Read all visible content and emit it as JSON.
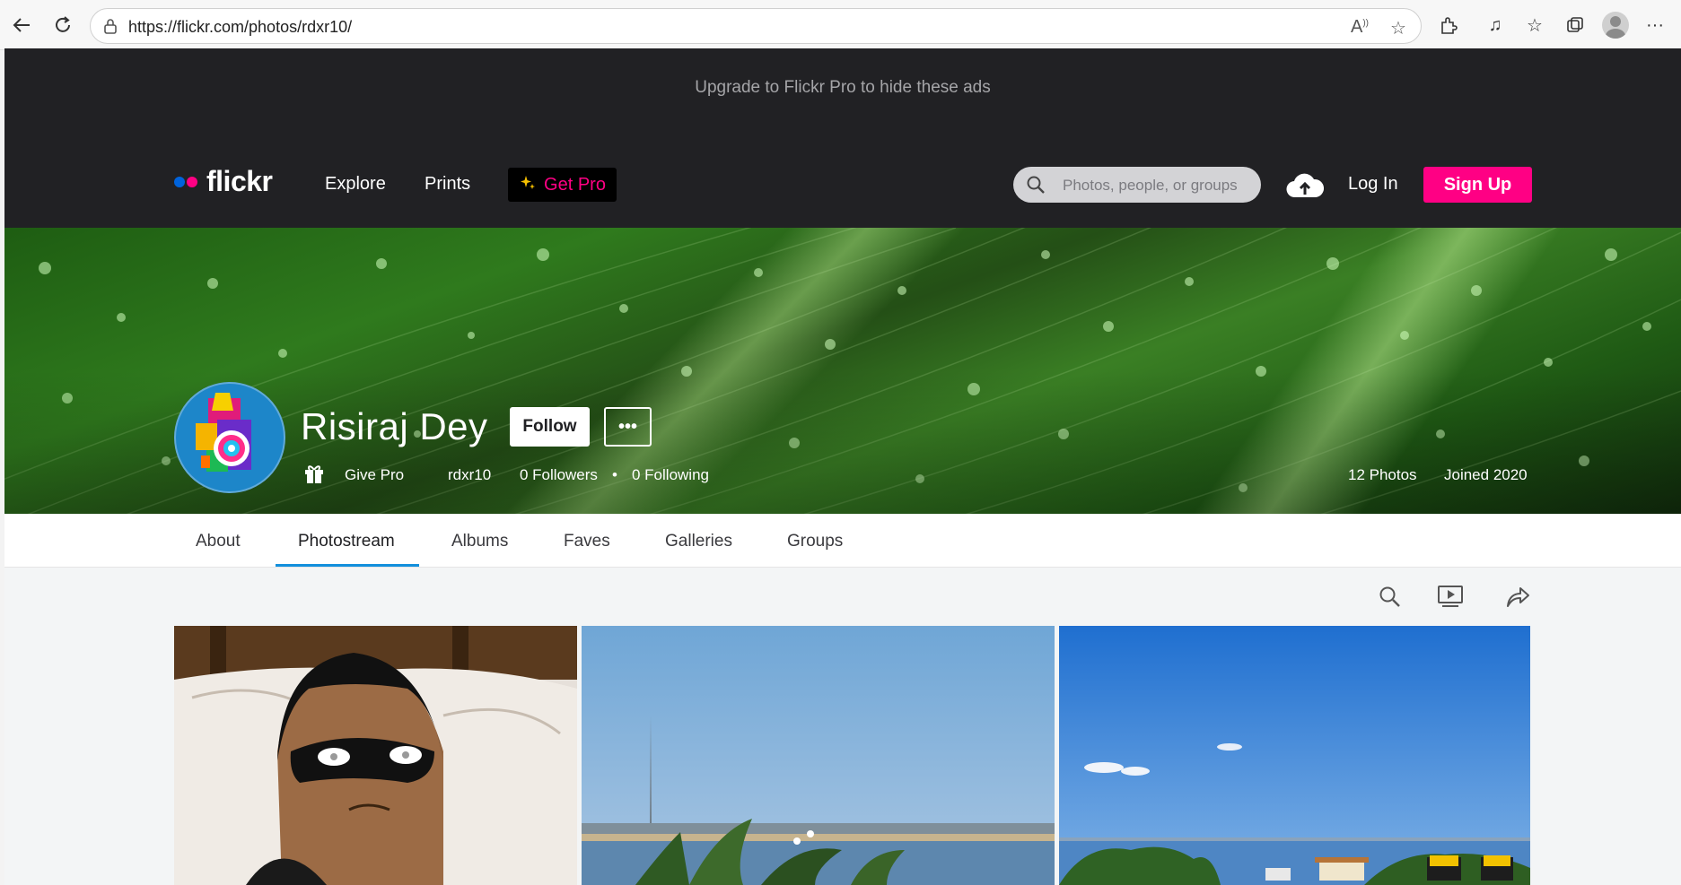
{
  "browser": {
    "url": "https://flickr.com/photos/rdxr10/",
    "icons": [
      "back-icon",
      "refresh-icon",
      "lock-icon",
      "read-aloud-icon",
      "favorite-star-icon",
      "extensions-icon",
      "media-icon",
      "favorites-icon",
      "collections-icon",
      "profile-icon",
      "more-icon"
    ]
  },
  "ad": {
    "text": "Upgrade to Flickr Pro to hide these ads"
  },
  "header": {
    "logo": "flickr",
    "nav": {
      "explore": "Explore",
      "prints": "Prints",
      "get_pro": "Get Pro"
    },
    "search_placeholder": "Photos, people, or groups",
    "login": "Log In",
    "signup": "Sign Up",
    "colors": {
      "brand_pink": "#ff0084",
      "brand_blue": "#0063dc",
      "bar": "#212124"
    }
  },
  "profile": {
    "name": "Risiraj Dey",
    "follow_label": "Follow",
    "more_label": "•••",
    "give_pro": "Give Pro",
    "username": "rdxr10",
    "followers": "0 Followers",
    "separator": "•",
    "following": "0 Following",
    "photos": "12 Photos",
    "joined": "Joined 2020"
  },
  "tabs": [
    "About",
    "Photostream",
    "Albums",
    "Faves",
    "Galleries",
    "Groups"
  ],
  "active_tab": "Photostream",
  "tools": [
    "search-icon",
    "slideshow-icon",
    "share-icon"
  ]
}
